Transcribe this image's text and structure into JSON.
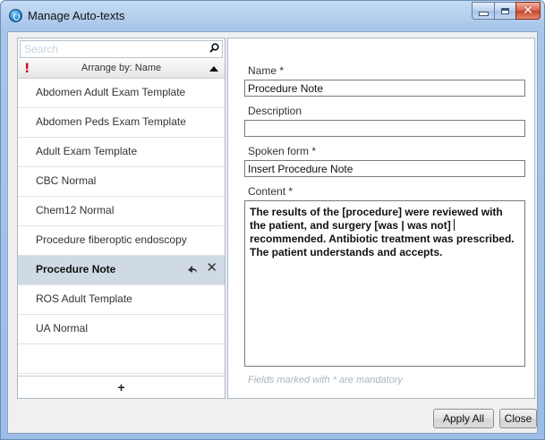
{
  "window": {
    "title": "Manage Auto-texts"
  },
  "search": {
    "placeholder": "Search"
  },
  "arrange": {
    "label": "Arrange by: Name",
    "mark": "!"
  },
  "list": {
    "items": [
      "Abdomen Adult Exam Template",
      "Abdomen Peds Exam Template",
      "Adult Exam Template",
      "CBC Normal",
      "Chem12 Normal",
      "Procedure fiberoptic endoscopy",
      "Procedure Note",
      "ROS Adult Template",
      "UA Normal",
      ""
    ],
    "selected": "Procedure Note",
    "delete_glyph": "✕",
    "add_label": "+"
  },
  "form": {
    "name_label": "Name *",
    "name_value": "Procedure Note",
    "description_label": "Description",
    "description_value": "",
    "spoken_label": "Spoken form *",
    "spoken_value": "Insert Procedure Note",
    "content_label": "Content *",
    "content_before_caret": "The results of the [procedure] were reviewed with the patient, and surgery [was | was not] ",
    "content_after_caret": "recommended. Antibiotic treatment was prescribed. The patient understands and accepts.",
    "hint": "Fields marked with * are mandatory"
  },
  "buttons": {
    "apply": "Apply All",
    "close": "Close"
  },
  "colors": {
    "selected_row": "#d0dae5",
    "title_gradient": "#a8c6ea",
    "close_button": "#c8412a",
    "required_mark": "#d0021b"
  }
}
